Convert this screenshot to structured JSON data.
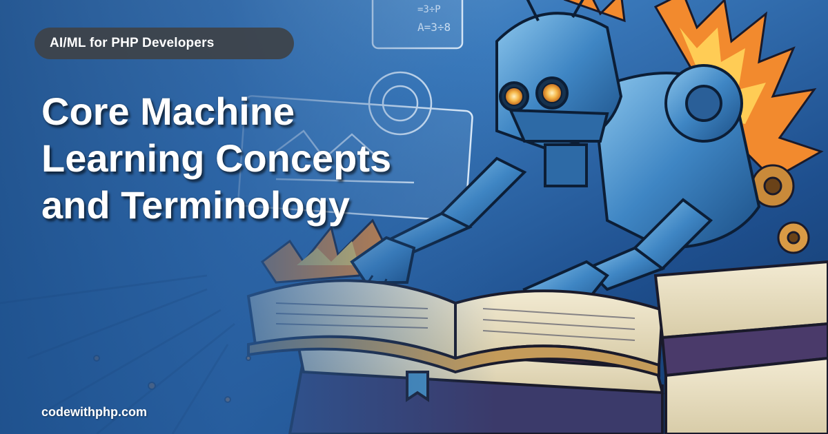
{
  "badge": {
    "label": "AI/ML for PHP Developers"
  },
  "title": {
    "lines": [
      "Core Machine",
      "Learning Concepts",
      "and Terminology"
    ]
  },
  "footer": {
    "site": "codewithphp.com"
  },
  "artwork": {
    "subject": "robot-reading-books-illustration",
    "screen_formulas": [
      "A=3÷8",
      "=3÷P"
    ]
  },
  "colors": {
    "background_blue": "#2a6aa8",
    "dark_blue": "#0f3a6e",
    "flame_orange": "#f28a2e",
    "badge_bg": "#3e4248",
    "text": "#ffffff"
  }
}
